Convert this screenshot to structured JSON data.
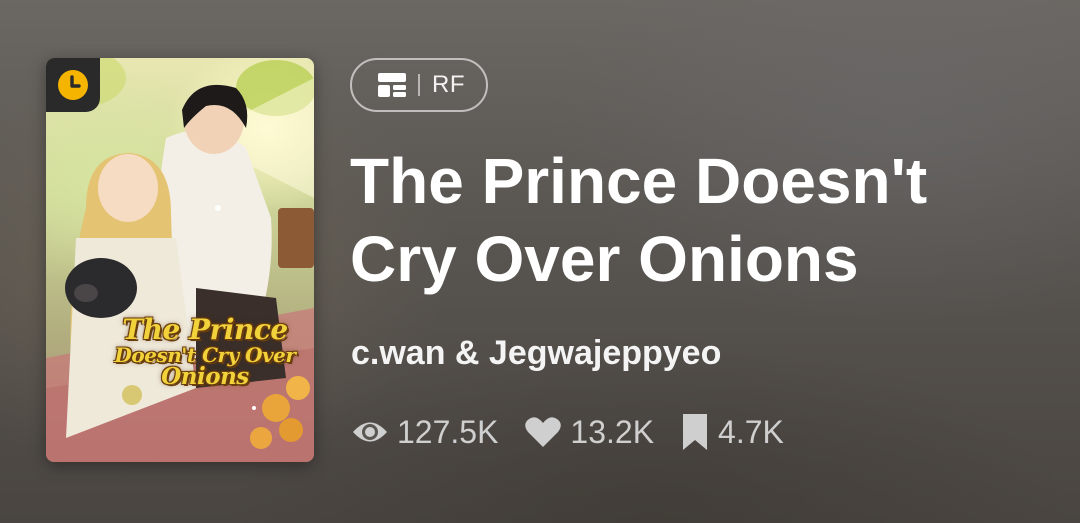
{
  "cover": {
    "title_line1": "The Prince",
    "title_line2": "Doesn't Cry Over",
    "title_line3": "Onions",
    "badge_icon": "clock-icon",
    "badge_color": "#f5b400"
  },
  "genre": {
    "icon": "layout-icon",
    "label": "RF"
  },
  "title": "The Prince Doesn't Cry Over Onions",
  "authors": "c.wan & Jegwajeppyeo",
  "stats": {
    "views": "127.5K",
    "likes": "13.2K",
    "bookmarks": "4.7K"
  }
}
